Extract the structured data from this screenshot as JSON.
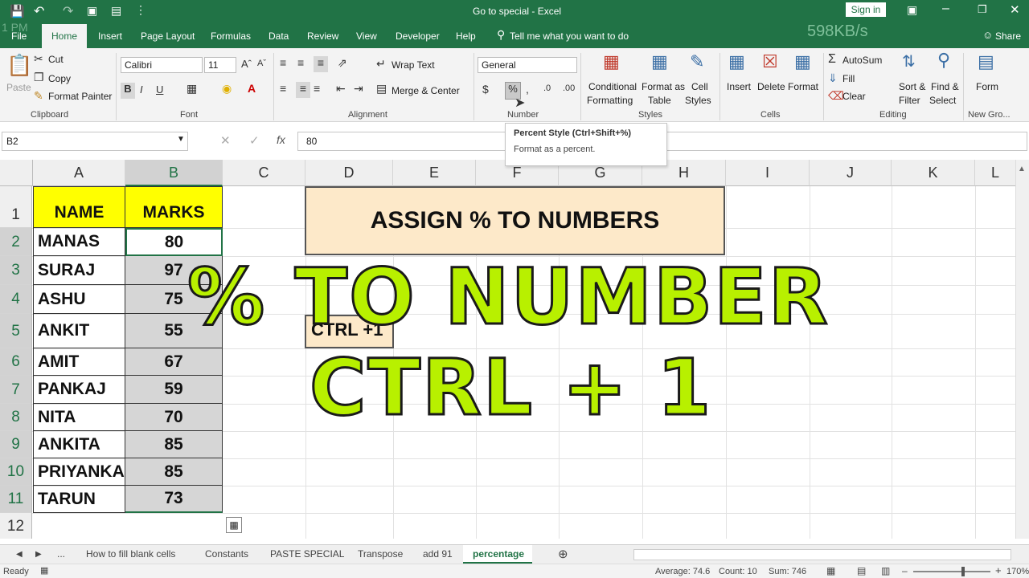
{
  "titlebar": {
    "title": "Go to special  -  Excel",
    "signin": "Sign in",
    "net_speed": "598KB/s",
    "time_fragment": "1 PM"
  },
  "menu": {
    "items": [
      "File",
      "Home",
      "Insert",
      "Page Layout",
      "Formulas",
      "Data",
      "Review",
      "View",
      "Developer",
      "Help"
    ],
    "tell_me": "Tell me what you want to do",
    "share": "Share"
  },
  "ribbon": {
    "clipboard": {
      "label": "Clipboard",
      "paste": "Paste",
      "cut": "Cut",
      "copy": "Copy",
      "format_painter": "Format Painter"
    },
    "font": {
      "label": "Font",
      "name": "Calibri",
      "size": "11"
    },
    "alignment": {
      "label": "Alignment",
      "wrap_text": "Wrap Text",
      "merge_center": "Merge & Center"
    },
    "number": {
      "label": "Number",
      "format": "General"
    },
    "styles": {
      "label": "Styles",
      "conditional_1": "Conditional",
      "conditional_2": "Formatting",
      "format_as_1": "Format as",
      "format_as_2": "Table",
      "cell_styles_1": "Cell",
      "cell_styles_2": "Styles"
    },
    "cells": {
      "label": "Cells",
      "insert": "Insert",
      "delete": "Delete",
      "format": "Format"
    },
    "editing": {
      "label": "Editing",
      "autosum": "AutoSum",
      "fill": "Fill",
      "clear": "Clear",
      "sort_1": "Sort &",
      "sort_2": "Filter",
      "find_1": "Find &",
      "find_2": "Select"
    },
    "newgroup": {
      "label": "New Gro...",
      "form": "Form"
    }
  },
  "tooltip": {
    "title": "Percent Style (Ctrl+Shift+%)",
    "desc": "Format as a percent."
  },
  "formula_bar": {
    "name_box": "B2",
    "value": "80"
  },
  "columns": [
    "A",
    "B",
    "C",
    "D",
    "E",
    "F",
    "G",
    "H",
    "I",
    "J",
    "K",
    "L"
  ],
  "rows": [
    "1",
    "2",
    "3",
    "4",
    "5",
    "6",
    "7",
    "8",
    "9",
    "10",
    "11",
    "12"
  ],
  "sheet": {
    "header_name": "NAME",
    "header_marks": "MARKS",
    "data": [
      {
        "name": "MANAS",
        "marks": "80"
      },
      {
        "name": "SURAJ",
        "marks": "97"
      },
      {
        "name": "ASHU",
        "marks": "75"
      },
      {
        "name": "ANKIT",
        "marks": "55"
      },
      {
        "name": "AMIT",
        "marks": "67"
      },
      {
        "name": "PANKAJ",
        "marks": "59"
      },
      {
        "name": "NITA",
        "marks": "70"
      },
      {
        "name": "ANKITA",
        "marks": "85"
      },
      {
        "name": "PRIYANKA",
        "marks": "85"
      },
      {
        "name": "TARUN",
        "marks": "73"
      }
    ],
    "banner": "ASSIGN % TO NUMBERS",
    "ctrl_box": "CTRL +1"
  },
  "overlay": {
    "line1": "% TO NUMBER",
    "line2": "CTRL + 1"
  },
  "tabs": [
    "...",
    "How to fill blank cells",
    "Constants",
    "PASTE SPECIAL",
    "Transpose",
    "add 91",
    "percentage"
  ],
  "status": {
    "ready": "Ready",
    "average": "Average: 74.6",
    "count": "Count: 10",
    "sum": "Sum: 746",
    "zoom": "170%"
  },
  "colors": {
    "excel_green": "#217346",
    "header_yellow": "#ffff00",
    "banner_bg": "#fde9c9",
    "overlay_green": "#b8f000"
  }
}
